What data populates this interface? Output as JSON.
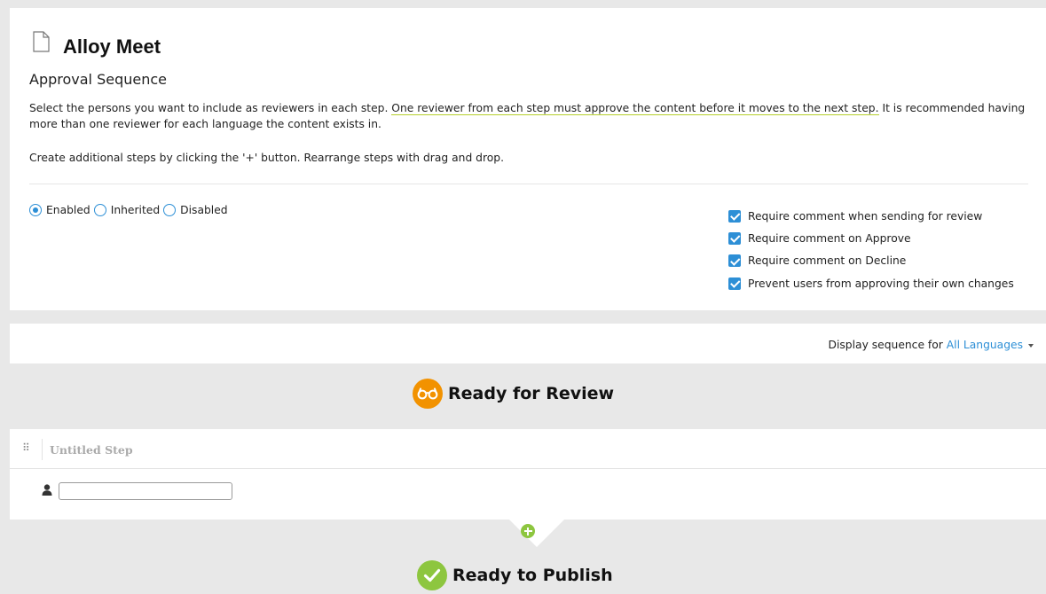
{
  "page": {
    "title": "Alloy Meet",
    "section_title": "Approval Sequence"
  },
  "description": {
    "part1": "Select the persons you want to include as reviewers in each step. ",
    "highlight": "One reviewer from each step must approve the content before it moves to the next step.",
    "part2": " It is recommended having more than one reviewer for each language the content exists in.",
    "line2": "Create additional steps by clicking the '+' button. Rearrange steps with drag and drop."
  },
  "status_options": [
    {
      "label": "Enabled",
      "selected": true
    },
    {
      "label": "Inherited",
      "selected": false
    },
    {
      "label": "Disabled",
      "selected": false
    }
  ],
  "options": [
    {
      "label": "Require comment when sending for review",
      "checked": true
    },
    {
      "label": "Require comment on Approve",
      "checked": true
    },
    {
      "label": "Require comment on Decline",
      "checked": true
    },
    {
      "label": "Prevent users from approving their own changes",
      "checked": true
    }
  ],
  "language": {
    "prefix": "Display sequence for",
    "value": "All Languages"
  },
  "stages": {
    "review": "Ready for Review",
    "publish": "Ready to Publish"
  },
  "step": {
    "name": "Untitled Step",
    "reviewer_value": ""
  },
  "colors": {
    "accent": "#2d8fd6",
    "review": "#f29200",
    "publish": "#8dc63f",
    "highlight_underline": "#b5cf2a"
  }
}
